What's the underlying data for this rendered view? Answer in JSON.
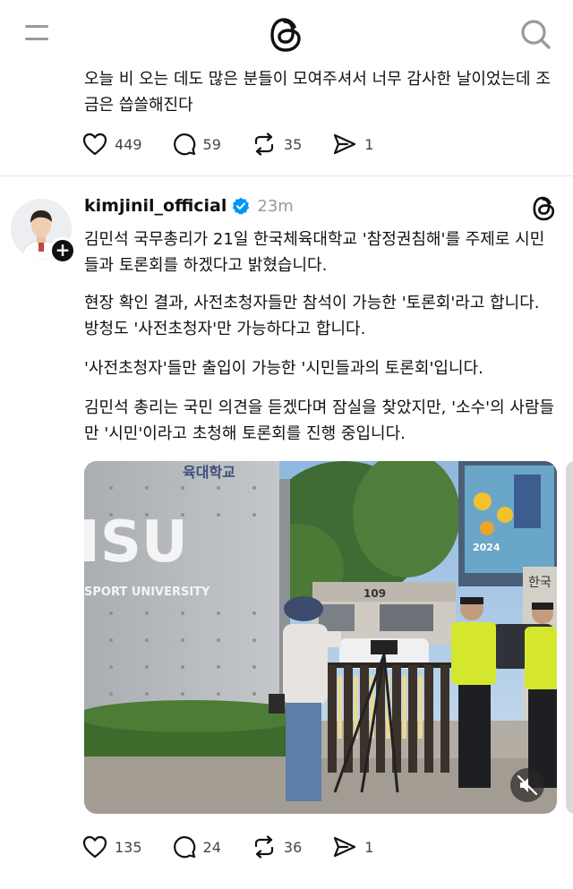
{
  "header": {
    "menu_icon": "hamburger-icon",
    "logo_icon": "threads-logo-icon",
    "search_icon": "search-icon"
  },
  "post1": {
    "text": "오늘 비 오는 데도 많은 분들이 모여주셔서 너무 감사한 날이었는데 조금은 씁쓸해진다",
    "likes": "449",
    "replies": "59",
    "reposts": "35",
    "shares": "1"
  },
  "post2": {
    "username": "kimjinil_official",
    "time": "23m",
    "paragraphs": [
      "김민석 국무총리가 21일 한국체육대학교 '참정권침해'를 주제로 시민들과 토론회를 하겠다고 밝혔습니다.",
      "현장 확인 결과, 사전초청자들만 참석이 가능한 '토론회'라고 합니다. 방청도 '사전초청자'만 가능하다고 합니다.",
      "'사전초청자'들만 출입이 가능한 '시민들과의 토론회'입니다.",
      "김민석 총리는 국민 의견을 듣겠다며 잠실을 찾았지만, '소수'의 사람들만 '시민'이라고 초청해 토론회를 진행 중입니다."
    ],
    "photo_text": {
      "wall_letters": "ISU",
      "wall_subtitle": "SPORT UNIVERSITY",
      "banner_top": "육대학교",
      "banner_year": "2024",
      "sign_right": "한국",
      "building_number": "109"
    },
    "likes": "135",
    "replies": "24",
    "reposts": "36",
    "shares": "1"
  },
  "colors": {
    "verified": "#0095f6",
    "icon_gray": "#9a9a9a",
    "text": "#101010"
  }
}
